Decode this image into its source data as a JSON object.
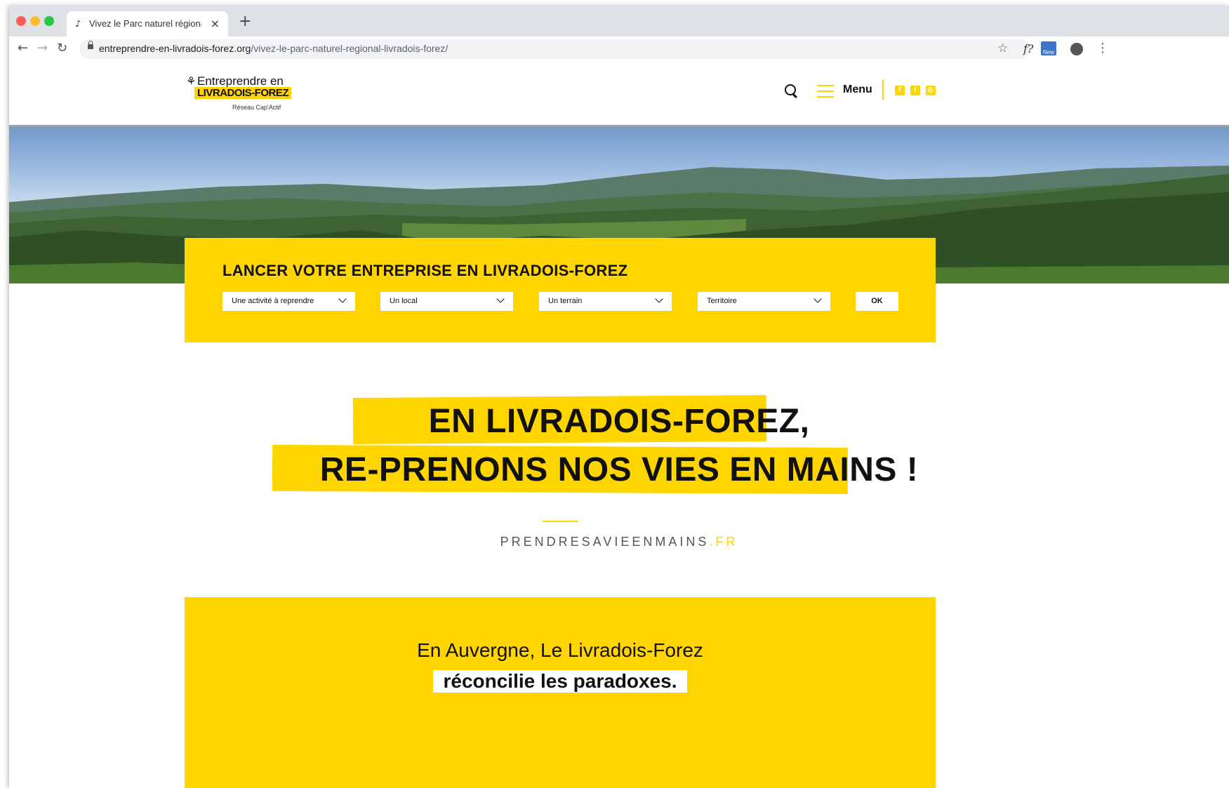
{
  "browser": {
    "tab_title": "Vivez le Parc naturel régional L",
    "tab_favicon": "♪",
    "close_glyph": "×",
    "new_tab_glyph": "+",
    "url_domain": "entreprendre-en-livradois-forez.org",
    "url_path": "/vivez-le-parc-naturel-regional-livradois-forez/",
    "back_glyph": "←",
    "forward_glyph": "→",
    "reload_glyph": "↻",
    "star_glyph": "☆",
    "extension_f_label": "f?",
    "extension_new_label": "New",
    "menu_glyph": "⋮",
    "traffic_lights": [
      "#fe5f57",
      "#febc2e",
      "#28c840"
    ]
  },
  "header": {
    "logo": {
      "mark": "⚘",
      "line1": "Entreprendre en",
      "line2": "LIVRADOIS-FOREZ",
      "tagline": "Réseau Cap'Actif"
    },
    "menu_label": "Menu",
    "social": [
      {
        "icon": "facebook-icon",
        "glyph": "f"
      },
      {
        "icon": "twitter-icon",
        "glyph": "t"
      },
      {
        "icon": "instagram-icon",
        "glyph": "◎"
      }
    ]
  },
  "search": {
    "title": "LANCER VOTRE ENTREPRISE EN LIVRADOIS-FOREZ",
    "selects": [
      {
        "label": "Une activité à reprendre"
      },
      {
        "label": "Un local"
      },
      {
        "label": "Un terrain"
      },
      {
        "label": "Territoire"
      }
    ],
    "ok_label": "OK"
  },
  "headline": {
    "line1": "EN LIVRADOIS-FOREZ,",
    "line2": "RE-PRENONS NOS VIES EN MAINS !"
  },
  "site_link": {
    "main": "PRENDRESAVIEENMAINS",
    "tld": ".FR"
  },
  "band": {
    "line1": "En Auvergne, Le Livradois-Forez",
    "line2": "réconcilie les paradoxes."
  },
  "colors": {
    "accent": "#ffd500",
    "text": "#111111"
  }
}
